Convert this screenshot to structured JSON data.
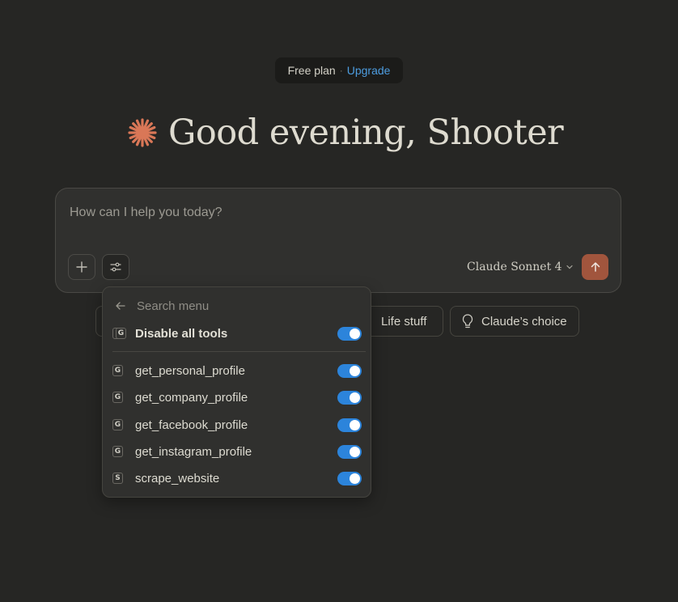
{
  "plan": {
    "label": "Free plan",
    "separator": "·",
    "upgrade_label": "Upgrade"
  },
  "greeting": {
    "text": "Good evening, Shooter"
  },
  "composer": {
    "placeholder": "How can I help you today?",
    "model_label": "Claude Sonnet 4"
  },
  "chips": [
    {
      "label": ""
    },
    {
      "label": "Life stuff"
    },
    {
      "label": "Claude’s choice"
    }
  ],
  "tools_menu": {
    "search_placeholder": "Search menu",
    "disable_all": {
      "label": "Disable all tools",
      "badge": "G",
      "enabled": true
    },
    "tools": [
      {
        "badge": "G",
        "name": "get_personal_profile",
        "enabled": true
      },
      {
        "badge": "G",
        "name": "get_company_profile",
        "enabled": true
      },
      {
        "badge": "G",
        "name": "get_facebook_profile",
        "enabled": true
      },
      {
        "badge": "G",
        "name": "get_instagram_profile",
        "enabled": true
      },
      {
        "badge": "S",
        "name": "scrape_website",
        "enabled": true
      }
    ]
  },
  "colors": {
    "background": "#262624",
    "accent_orange": "#d97757",
    "send_button": "#a1553d",
    "toggle_on": "#2c84db",
    "link_blue": "#4d9de0"
  },
  "icons": [
    "claude-spark-icon",
    "plus-icon",
    "sliders-icon",
    "chevron-down-icon",
    "arrow-up-icon",
    "arrow-left-icon",
    "lightbulb-icon"
  ]
}
